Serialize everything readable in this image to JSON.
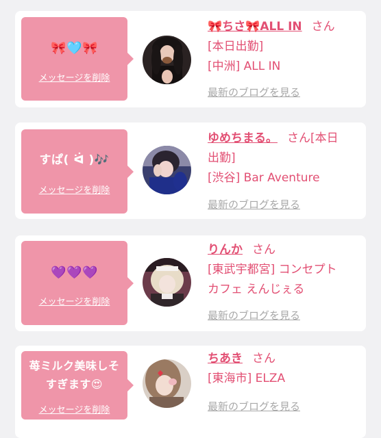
{
  "colors": {
    "background": "#f1f1f3",
    "bubble": "#ef95a9",
    "accent_text": "#e24f73",
    "blog_link": "#a8a8a8"
  },
  "cards": [
    {
      "message": "🎀🩵🎀",
      "delete_label": "メッセージを削除",
      "name": "🎀ちさ🎀ALL IN",
      "honorific": "さん",
      "status": "[本日出勤]",
      "shop": "[中洲] ALL IN",
      "blog_label": "最新のブログを見る"
    },
    {
      "message": "すぱ( ᐛ )🎶",
      "delete_label": "メッセージを削除",
      "name": "ゆめちまる。",
      "honorific": "さん[本日",
      "status_cont": "出勤]",
      "shop": "[渋谷] Bar Aventure",
      "blog_label": "最新のブログを見る"
    },
    {
      "message": "💜💜💜",
      "delete_label": "メッセージを削除",
      "name": "りんか",
      "honorific": "さん",
      "shop_line1": "[東武宇都宮] コンセプト",
      "shop_line2": "カフェ えんじぇる",
      "blog_label": "最新のブログを見る"
    },
    {
      "message_line1": "苺ミルク美味しそ",
      "message_line2": "すぎます😍",
      "delete_label": "メッセージを削除",
      "name": "ちあき",
      "honorific": "さん",
      "shop": "[東海市] ELZA",
      "blog_label": "最新のブログを見る"
    }
  ]
}
